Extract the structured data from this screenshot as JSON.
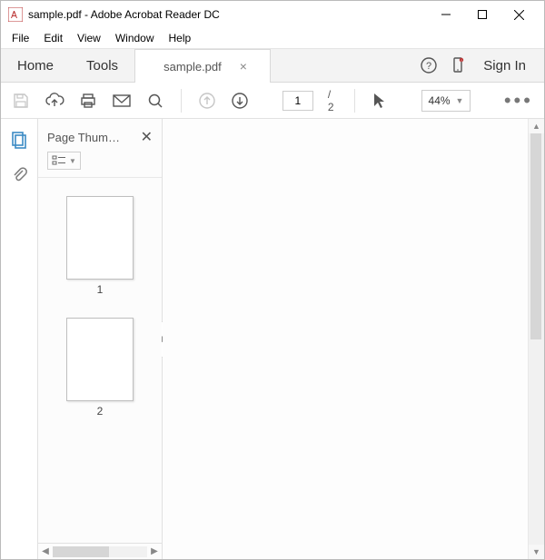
{
  "window": {
    "title": "sample.pdf - Adobe Acrobat Reader DC"
  },
  "menubar": {
    "file": "File",
    "edit": "Edit",
    "view": "View",
    "window": "Window",
    "help": "Help"
  },
  "tabs": {
    "home": "Home",
    "tools": "Tools",
    "doc": "sample.pdf",
    "signin": "Sign In"
  },
  "toolbar": {
    "page_current": "1",
    "page_total": "/  2",
    "zoom": "44%"
  },
  "panel": {
    "title": "Page Thum…",
    "thumbs": [
      {
        "label": "1"
      },
      {
        "label": "2"
      }
    ]
  }
}
